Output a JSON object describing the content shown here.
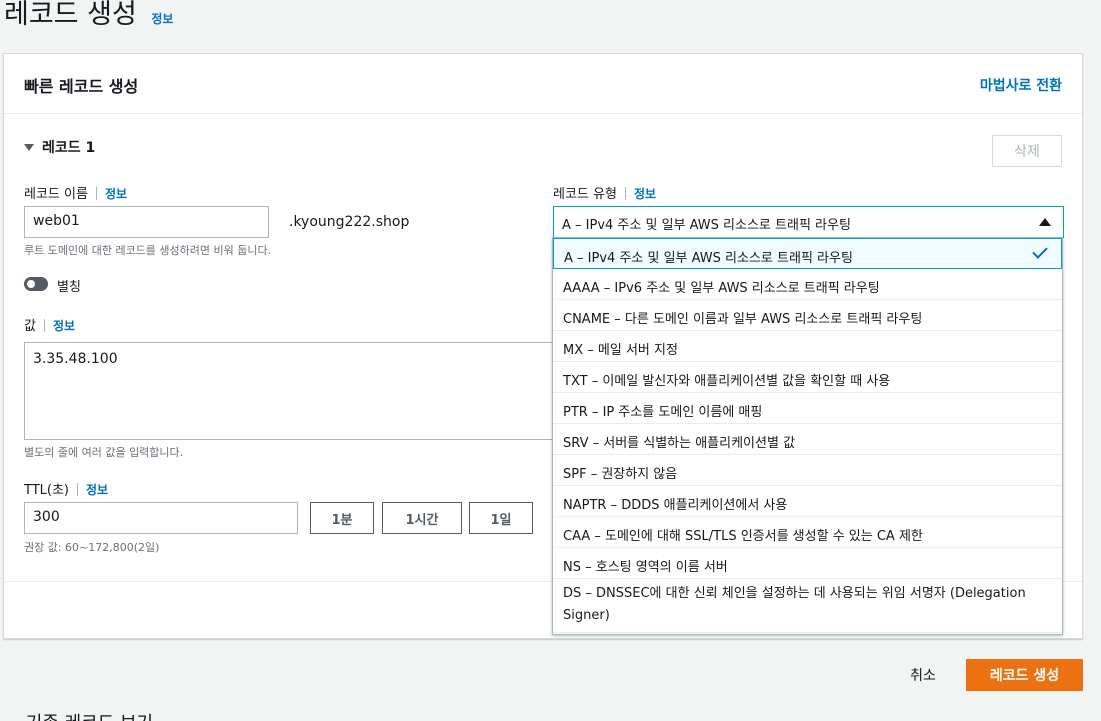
{
  "page": {
    "title": "레코드 생성",
    "info": "정보"
  },
  "card": {
    "title": "빠른 레코드 생성",
    "wizard_link": "마법사로 전환"
  },
  "record": {
    "header": "레코드 1",
    "delete_label": "삭제",
    "name_label": "레코드 이름",
    "name_info": "정보",
    "name_value": "web01",
    "domain_suffix": ".kyoung222.shop",
    "name_hint": "루트 도메인에 대한 레코드를 생성하려면 비워 둡니다.",
    "alias_label": "별칭",
    "value_label": "값",
    "value_info": "정보",
    "value_text": "3.35.48.100",
    "value_hint": "별도의 줄에 여러 값을 입력합니다.",
    "ttl_label": "TTL(초)",
    "ttl_info": "정보",
    "ttl_value": "300",
    "ttl_buttons": [
      "1분",
      "1시간",
      "1일"
    ],
    "ttl_hint": "권장 값: 60~172,800(2일)",
    "type_label": "레코드 유형",
    "type_info": "정보",
    "type_selected": "A – IPv4 주소 및 일부 AWS 리소스로 트래픽 라우팅"
  },
  "dropdown": {
    "options": [
      "A – IPv4 주소 및 일부 AWS 리소스로 트래픽 라우팅",
      "AAAA – IPv6 주소 및 일부 AWS 리소스로 트래픽 라우팅",
      "CNAME – 다른 도메인 이름과 일부 AWS 리소스로 트래픽 라우팅",
      "MX – 메일 서버 지정",
      "TXT – 이메일 발신자와 애플리케이션별 값을 확인할 때 사용",
      "PTR – IP 주소를 도메인 이름에 매핑",
      "SRV – 서버를 식별하는 애플리케이션별 값",
      "SPF – 권장하지 않음",
      "NAPTR – DDDS 애플리케이션에서 사용",
      "CAA – 도메인에 대해 SSL/TLS 인증서를 생성할 수 있는 CA 제한",
      "NS – 호스팅 영역의 이름 서버",
      "DS – DNSSEC에 대한 신뢰 체인을 설정하는 데 사용되는 위임 서명자 (Delegation Signer)"
    ]
  },
  "footer": {
    "cancel": "취소",
    "create": "레코드 생성",
    "existing_records": "기존 레코드 보기"
  },
  "colors": {
    "primary": "#ec7211",
    "link": "#0073bb",
    "focus": "#00a1c9"
  }
}
